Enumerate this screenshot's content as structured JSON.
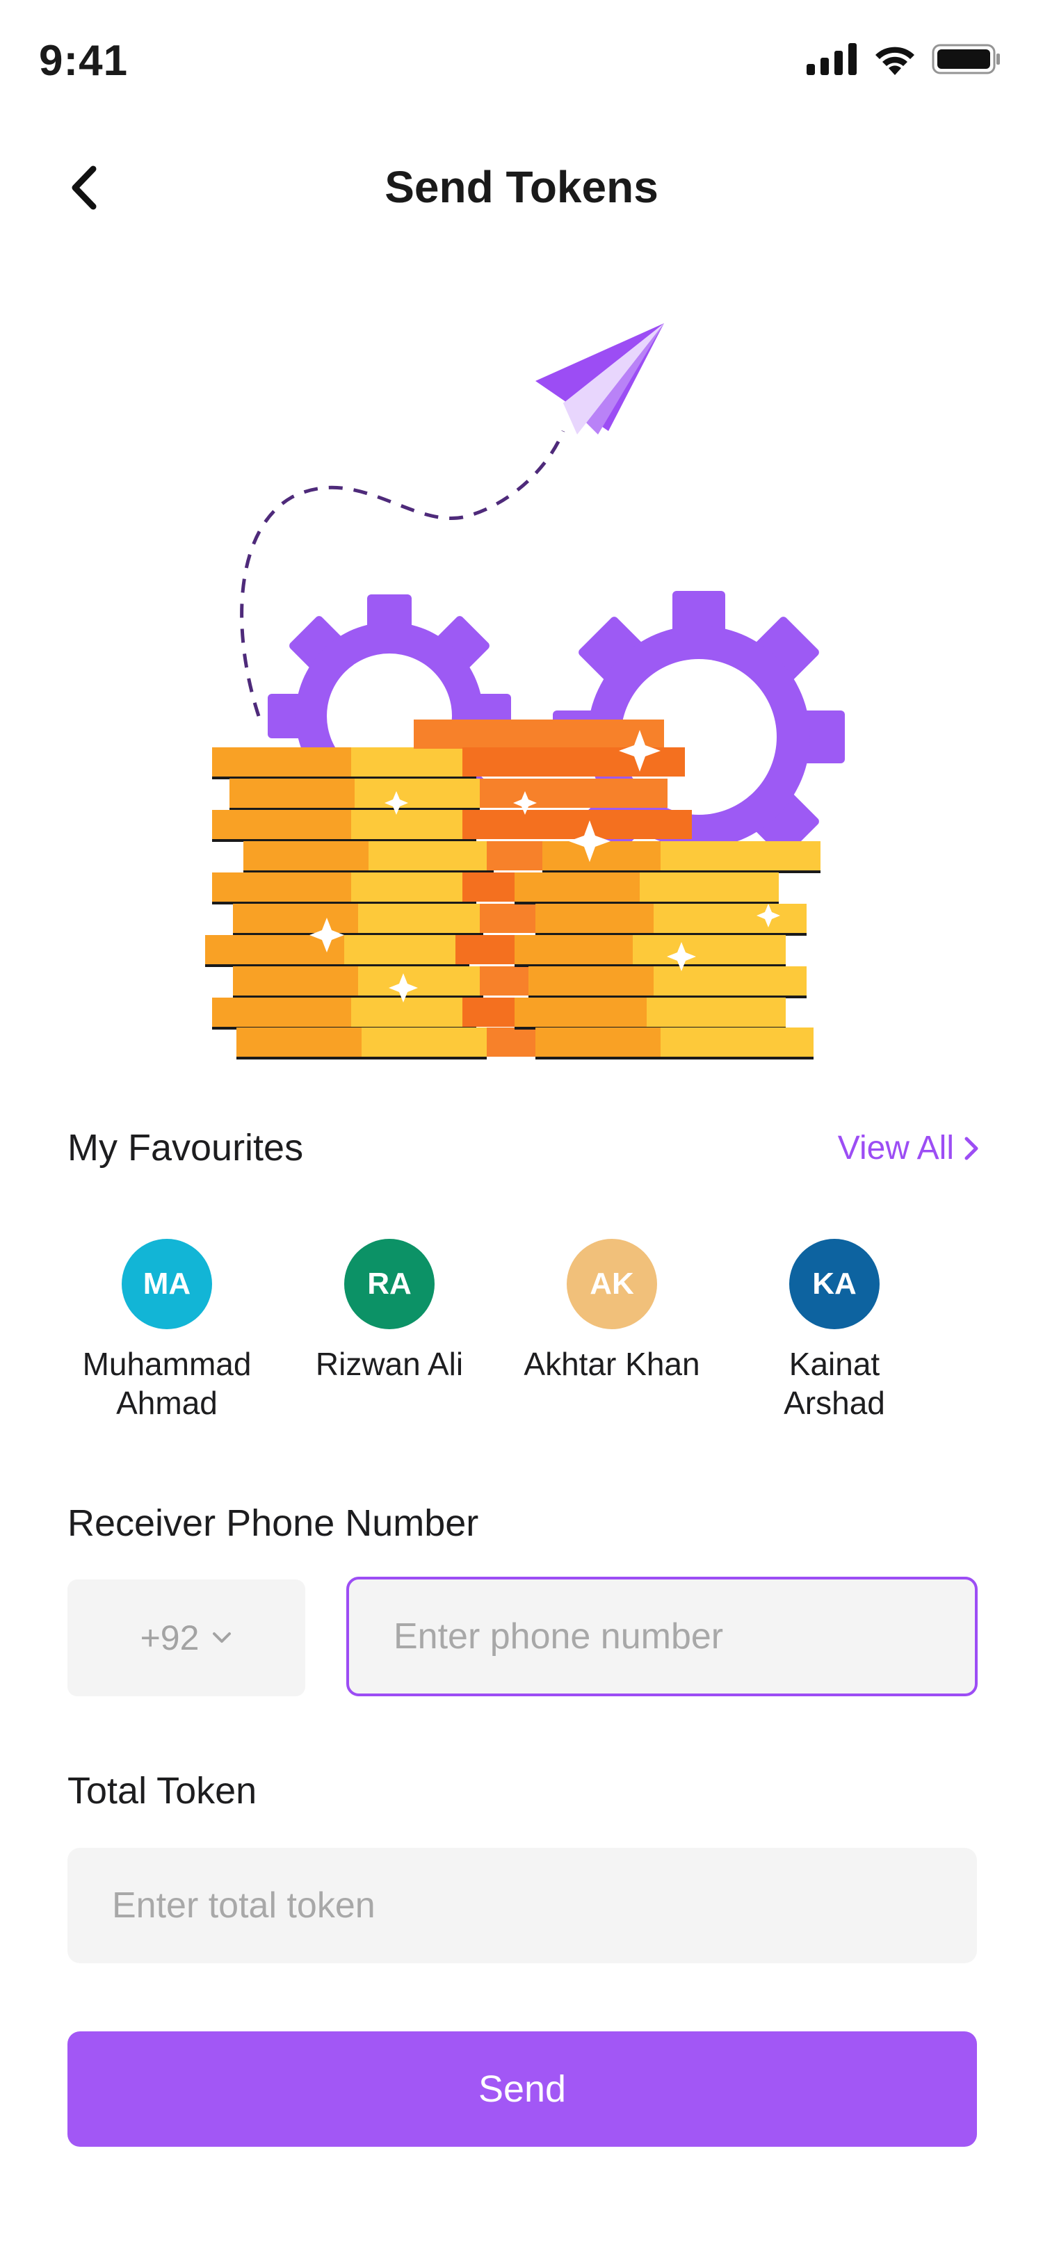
{
  "status_bar": {
    "time": "9:41"
  },
  "header": {
    "title": "Send Tokens"
  },
  "favourites": {
    "title": "My Favourites",
    "view_all": "View All",
    "items": [
      {
        "initials": "MA",
        "name": "Muhammad Ahmad",
        "color": "#12b5d6"
      },
      {
        "initials": "RA",
        "name": "Rizwan Ali",
        "color": "#0c9266"
      },
      {
        "initials": "AK",
        "name": "Akhtar Khan",
        "color": "#f1c07a"
      },
      {
        "initials": "KA",
        "name": "Kainat Arshad",
        "color": "#0d63a0"
      }
    ]
  },
  "receiver": {
    "label": "Receiver Phone Number",
    "country_code": "+92",
    "phone_placeholder": "Enter phone number"
  },
  "total_token": {
    "label": "Total Token",
    "placeholder": "Enter total token"
  },
  "send_button": {
    "label": "Send"
  },
  "colors": {
    "accent": "#a257f5",
    "gear": "#9d5af4",
    "coin_dark": "#f9a125",
    "coin_light": "#fdc93a",
    "coin_orange": "#f4701f"
  }
}
